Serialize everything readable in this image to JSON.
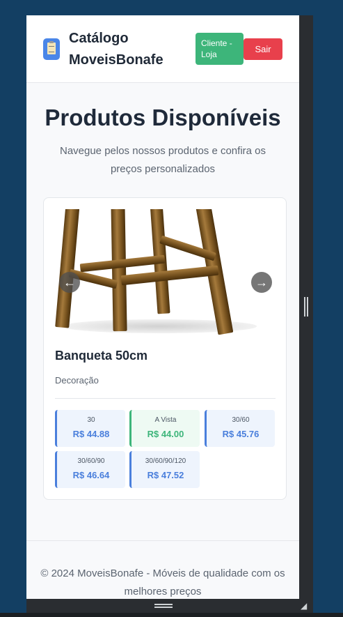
{
  "header": {
    "brand": "Catálogo MoveisBonafe",
    "logo_icon": "clipboard-icon",
    "client_button": "Cliente - Loja",
    "logout_button": "Sair"
  },
  "hero": {
    "title": "Produtos Disponíveis",
    "subtitle": "Navegue pelos nossos produtos e confira os preços personalizados"
  },
  "product": {
    "name": "Banqueta 50cm",
    "category": "Decoração",
    "carousel": {
      "prev_icon": "←",
      "next_icon": "→",
      "slides": 2,
      "active_slide": 1
    },
    "prices": [
      {
        "label": "30",
        "value": "R$ 44.88",
        "accent": "#4a7fdc"
      },
      {
        "label": "A Vista",
        "value": "R$ 44.00",
        "accent": "#3db57a"
      },
      {
        "label": "30/60",
        "value": "R$ 45.76",
        "accent": "#4a7fdc"
      },
      {
        "label": "30/60/90",
        "value": "R$ 46.64",
        "accent": "#4a7fdc"
      },
      {
        "label": "30/60/90/120",
        "value": "R$ 47.52",
        "accent": "#4a7fdc"
      }
    ]
  },
  "footer": {
    "text": "© 2024 MoveisBonafe - Móveis de qualidade com os melhores preços"
  },
  "colors": {
    "background": "#133f63",
    "primary": "#4a7fdc",
    "success": "#3db57a",
    "danger": "#e8404c"
  }
}
